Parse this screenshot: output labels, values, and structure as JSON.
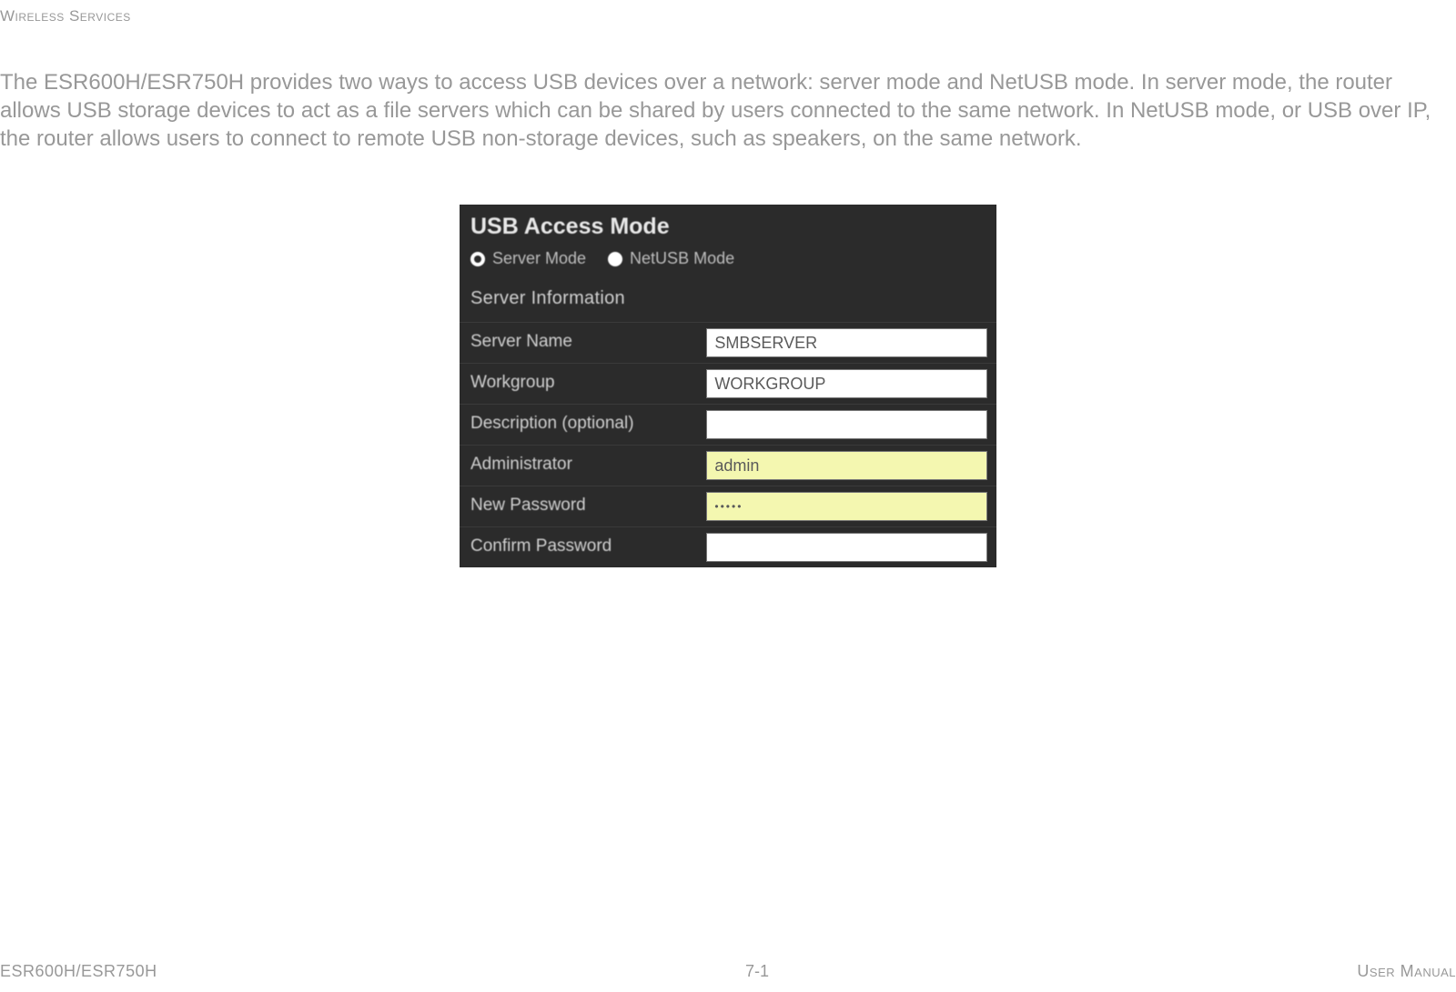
{
  "header": {
    "section_label": "Wireless Services"
  },
  "body": {
    "paragraph": "The ESR600H/ESR750H provides two ways to access USB devices over a network: server mode and NetUSB mode. In server mode, the router allows USB storage devices to act as a file servers which can be shared by users connected to the same network. In NetUSB mode, or USB over IP, the router allows users to connect to remote USB non-storage devices, such as speakers, on the same network."
  },
  "panel": {
    "title": "USB Access Mode",
    "radios": [
      {
        "label": "Server Mode",
        "selected": true
      },
      {
        "label": "NetUSB Mode",
        "selected": false
      }
    ],
    "section_label": "Server Information",
    "rows": [
      {
        "label": "Server Name",
        "value": "SMBSERVER",
        "yellow": false
      },
      {
        "label": "Workgroup",
        "value": "WORKGROUP",
        "yellow": false
      },
      {
        "label": "Description (optional)",
        "value": "",
        "yellow": false
      },
      {
        "label": "Administrator",
        "value": "admin",
        "yellow": true
      },
      {
        "label": "New Password",
        "value": "•••••",
        "yellow": true
      },
      {
        "label": "Confirm Password",
        "value": "",
        "yellow": false
      }
    ]
  },
  "footer": {
    "left": "ESR600H/ESR750H",
    "center": "7-1",
    "right": "User Manual"
  }
}
